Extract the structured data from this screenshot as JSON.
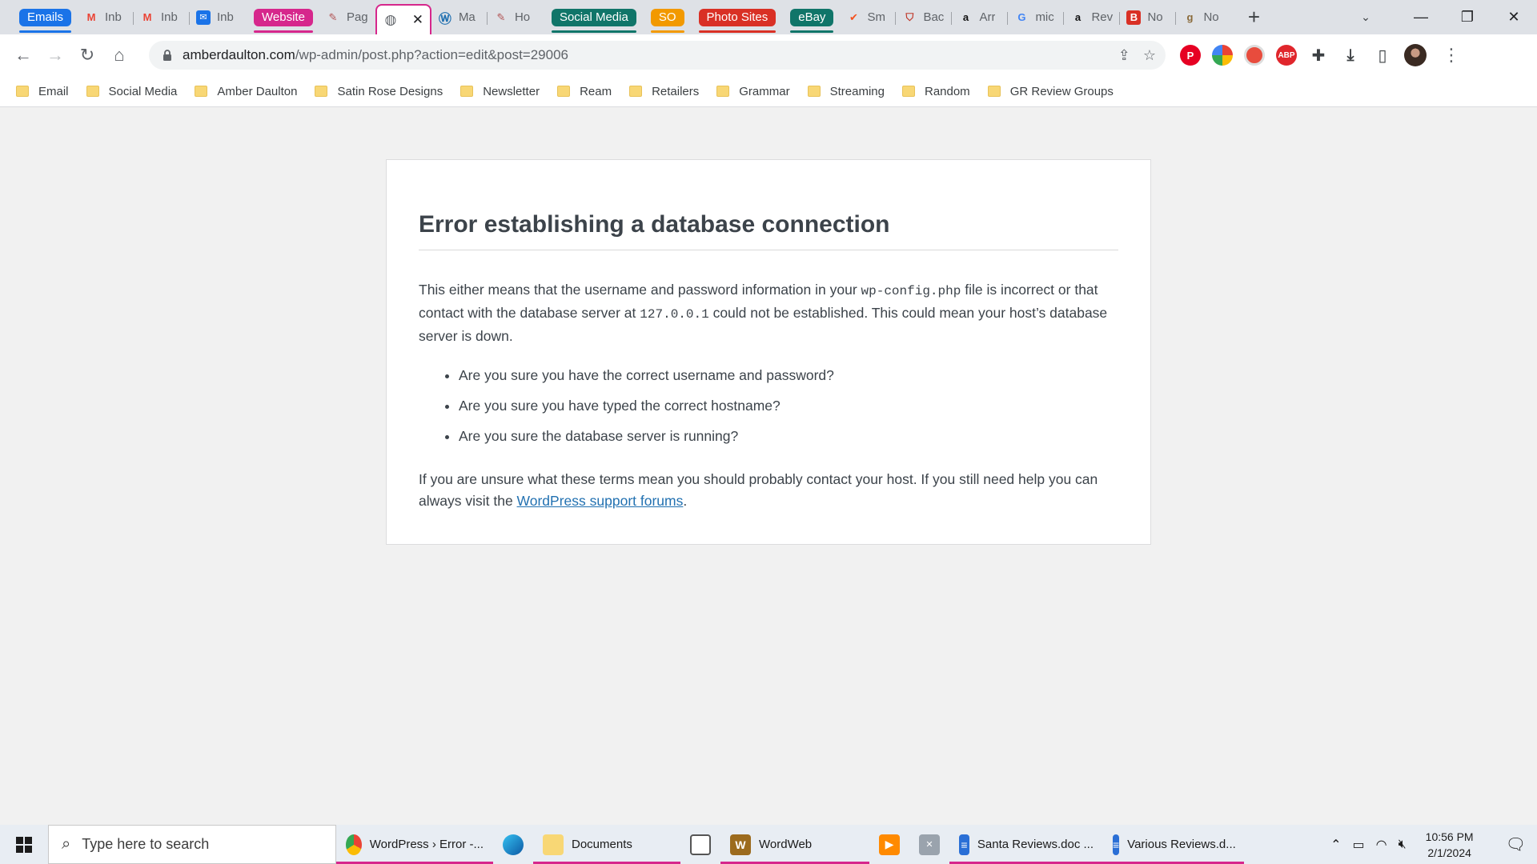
{
  "tabs": {
    "groups": [
      {
        "label": "Emails",
        "color": "#1a73e8"
      },
      {
        "label": "Website",
        "color": "#d6278c"
      },
      {
        "label": "Social Media",
        "color": "#107569"
      },
      {
        "label": "SO",
        "color": "#f29900"
      },
      {
        "label": "Photo Sites",
        "color": "#d93025"
      },
      {
        "label": "eBay",
        "color": "#107569"
      }
    ],
    "items": [
      {
        "label": "Inb",
        "icon": "gmail-icon"
      },
      {
        "label": "Inb",
        "icon": "gmail-icon"
      },
      {
        "label": "Inb",
        "icon": "mail-icon"
      },
      {
        "label": "Pag",
        "icon": "page-icon"
      },
      {
        "label": "",
        "icon": "globe-icon"
      },
      {
        "label": "Ma",
        "icon": "wordpress-icon"
      },
      {
        "label": "Ho",
        "icon": "page-icon"
      },
      {
        "label": "Sm",
        "icon": "check-icon"
      },
      {
        "label": "Bac",
        "icon": "shield-icon"
      },
      {
        "label": "Arr",
        "icon": "amazon-icon"
      },
      {
        "label": "mic",
        "icon": "google-icon"
      },
      {
        "label": "Rev",
        "icon": "amazon-icon"
      },
      {
        "label": "No",
        "icon": "b-icon"
      },
      {
        "label": "No",
        "icon": "goodreads-icon"
      }
    ]
  },
  "toolbar": {
    "url_host": "amberdaulton.com",
    "url_path": "/wp-admin/post.php?action=edit&post=29006"
  },
  "bookmarks": [
    "Email",
    "Social Media",
    "Amber Daulton",
    "Satin Rose Designs",
    "Newsletter",
    "Ream",
    "Retailers",
    "Grammar",
    "Streaming",
    "Random",
    "GR Review Groups"
  ],
  "error": {
    "title": "Error establishing a database connection",
    "p1_a": "This either means that the username and password information in your ",
    "p1_code1": "wp-config.php",
    "p1_b": " file is incorrect or that contact with the database server at ",
    "p1_code2": "127.0.0.1",
    "p1_c": " could not be established. This could mean your host’s database server is down.",
    "bullets": [
      "Are you sure you have the correct username and password?",
      "Are you sure you have typed the correct hostname?",
      "Are you sure the database server is running?"
    ],
    "p2_a": "If you are unsure what these terms mean you should probably contact your host. If you still need help you can always visit the ",
    "p2_link": "WordPress support forums",
    "p2_b": "."
  },
  "taskbar": {
    "search_placeholder": "Type here to search",
    "apps": [
      "WordPress › Error -...",
      "Documents",
      "WordWeb",
      "Santa Reviews.doc ...",
      "Various Reviews.d..."
    ],
    "time": "10:56 PM",
    "date": "2/1/2024"
  }
}
